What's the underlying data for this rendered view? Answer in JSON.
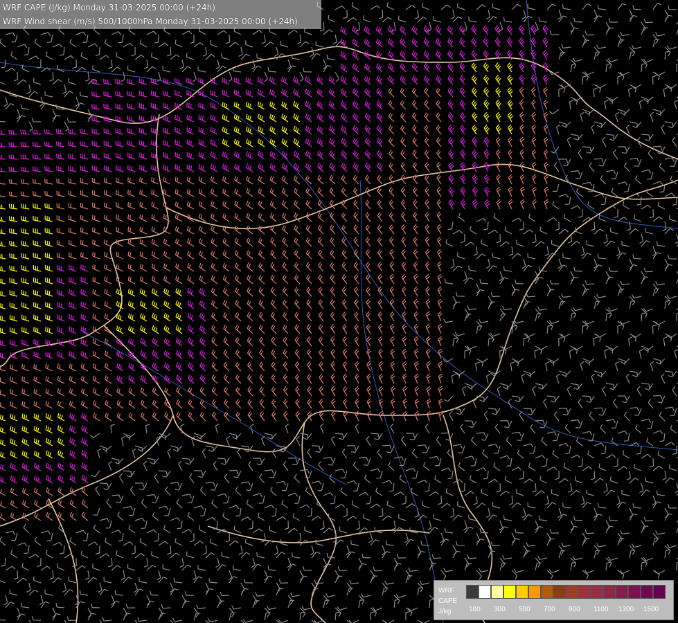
{
  "titles": {
    "line1": "WRF CAPE (J/kg) Monday 31-03-2025 00:00 (+24h)",
    "line2": "WRF Wind shear (m/s) 500/1000hPa Monday 31-03-2025 00:00 (+24h)"
  },
  "legend": {
    "label1": "WRF",
    "label2": "CAPE",
    "label3": "J/kg",
    "swatches": [
      "#3a3a3a",
      "#ffffff",
      "#ffff9c",
      "#ffff00",
      "#ffcc00",
      "#f59a00",
      "#b45a10",
      "#8c3c14",
      "#a03c28",
      "#a0303c",
      "#963044",
      "#8c2848",
      "#82204c",
      "#781450",
      "#6e0a50",
      "#640050"
    ],
    "tick_labels": [
      "100",
      "300",
      "500",
      "700",
      "900",
      "1100",
      "1300",
      "1500"
    ]
  },
  "shear_colors": {
    "weak": "#8c8c8c",
    "moderate": "#e07a6a",
    "strong": "#e020e0",
    "very_strong": "#ffff00"
  },
  "border_color": "#e8c8a0",
  "river_color": "#3060c0"
}
